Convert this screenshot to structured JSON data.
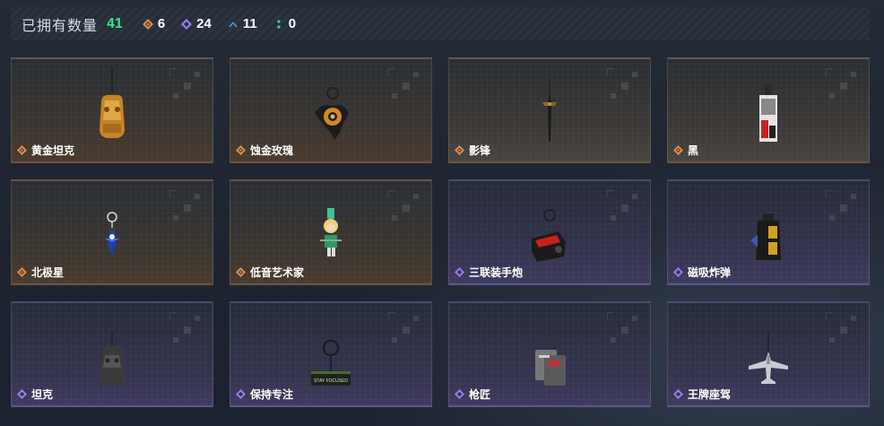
{
  "header": {
    "title": "已拥有数量",
    "owned_count": "41",
    "stats": [
      {
        "icon": "orange-diamond-icon",
        "color": "#e08a4a",
        "value": "6"
      },
      {
        "icon": "purple-diamond-icon",
        "color": "#9a7bf0",
        "value": "24"
      },
      {
        "icon": "blue-chevron-icon",
        "color": "#4a9be0",
        "value": "11"
      },
      {
        "icon": "green-dots-icon",
        "color": "#3fd0a0",
        "value": "0"
      }
    ]
  },
  "rarity_colors": {
    "orange": "#e08a4a",
    "purple": "#9a7bf0"
  },
  "charms": [
    {
      "name": "黄金坦克",
      "rarity": "orange",
      "icon": "gold-tank-charm-icon"
    },
    {
      "name": "蚀金玫瑰",
      "rarity": "orange",
      "icon": "gold-rose-charm-icon"
    },
    {
      "name": "影锋",
      "rarity": "orange",
      "icon": "shadow-blade-charm-icon"
    },
    {
      "name": "黑",
      "rarity": "orange",
      "icon": "black-tag-charm-icon"
    },
    {
      "name": "北极星",
      "rarity": "orange",
      "icon": "north-star-charm-icon"
    },
    {
      "name": "低音艺术家",
      "rarity": "orange",
      "icon": "bass-artist-charm-icon"
    },
    {
      "name": "三联装手炮",
      "rarity": "purple",
      "icon": "triple-hand-cannon-charm-icon"
    },
    {
      "name": "磁吸炸弹",
      "rarity": "purple",
      "icon": "magnetic-bomb-charm-icon"
    },
    {
      "name": "坦克",
      "rarity": "purple",
      "icon": "tank-charm-icon"
    },
    {
      "name": "保持专注",
      "rarity": "purple",
      "icon": "stay-focused-charm-icon"
    },
    {
      "name": "枪匠",
      "rarity": "purple",
      "icon": "gunsmith-charm-icon"
    },
    {
      "name": "王牌座驾",
      "rarity": "purple",
      "icon": "ace-jet-charm-icon"
    }
  ],
  "charm_art_text": {
    "stay_focused": "STAY FOCUSED"
  }
}
